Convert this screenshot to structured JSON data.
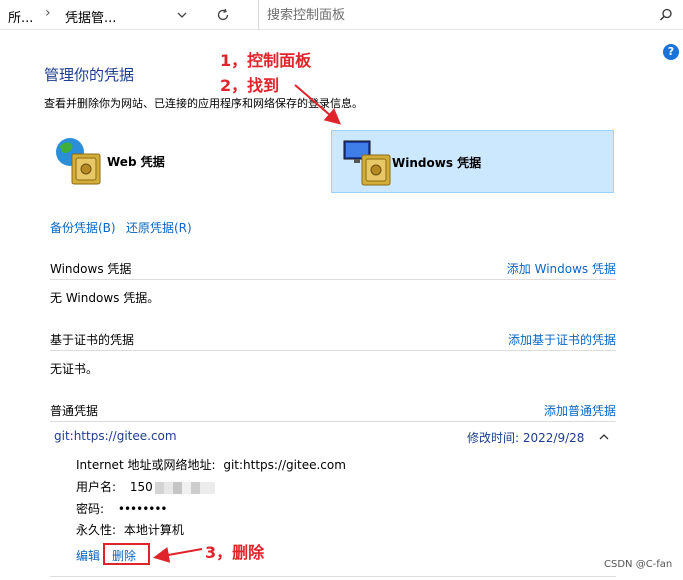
{
  "address_bar": {
    "crumb_1": "所...",
    "crumb_2": "凭据管...",
    "search_placeholder": "搜索控制面板"
  },
  "header": {
    "title": "管理你的凭据",
    "subtitle": "查看并删除你为网站、已连接的应用程序和网络保存的登录信息。"
  },
  "annotations": {
    "step1": "1，控制面板",
    "step2": "2，找到",
    "step3": "3，删除",
    "color": "#e0242b"
  },
  "tiles": {
    "web": "Web 凭据",
    "windows": "Windows 凭据"
  },
  "actions": {
    "backup": "备份凭据(B)",
    "restore": "还原凭据(R)"
  },
  "sections": {
    "windows": {
      "heading": "Windows 凭据",
      "add": "添加 Windows 凭据",
      "empty": "无 Windows 凭据。"
    },
    "certificate": {
      "heading": "基于证书的凭据",
      "add": "添加基于证书的凭据",
      "empty": "无证书。"
    },
    "generic": {
      "heading": "普通凭据",
      "add": "添加普通凭据"
    }
  },
  "credential": {
    "name": "git:https://gitee.com",
    "modified": "修改时间:  2022/9/28",
    "address_label": "Internet 地址或网络地址:",
    "address_value": "git:https://gitee.com",
    "user_label": "用户名:",
    "user_value": "150",
    "password_label": "密码:",
    "password_value": "••••••••",
    "persistence_label": "永久性:",
    "persistence_value": "本地计算机",
    "edit": "编辑",
    "delete": "删除"
  },
  "watermark": "CSDN @C-fan",
  "colors": {
    "link": "#0a66c2",
    "title": "#1e3d8f",
    "selected_tile": "#cce8ff"
  }
}
